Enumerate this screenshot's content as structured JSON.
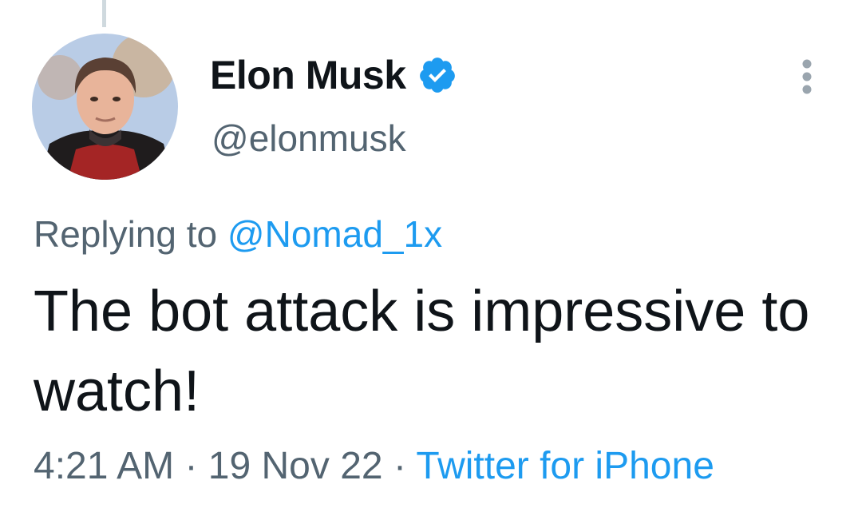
{
  "tweet": {
    "display_name": "Elon Musk",
    "handle": "@elonmusk",
    "reply_prefix": "Replying to",
    "reply_handle": "@Nomad_1x",
    "text": "The bot attack is impressive to watch!",
    "time": "4:21 AM",
    "separator": "·",
    "date": "19 Nov 22",
    "source": "Twitter for iPhone"
  },
  "icons": {
    "verified": "verified-badge-icon",
    "more": "more-vertical-icon"
  },
  "colors": {
    "accent": "#1d9bf0",
    "text_primary": "#0f1419",
    "text_secondary": "#536471",
    "thread_line": "#cfd9de"
  }
}
